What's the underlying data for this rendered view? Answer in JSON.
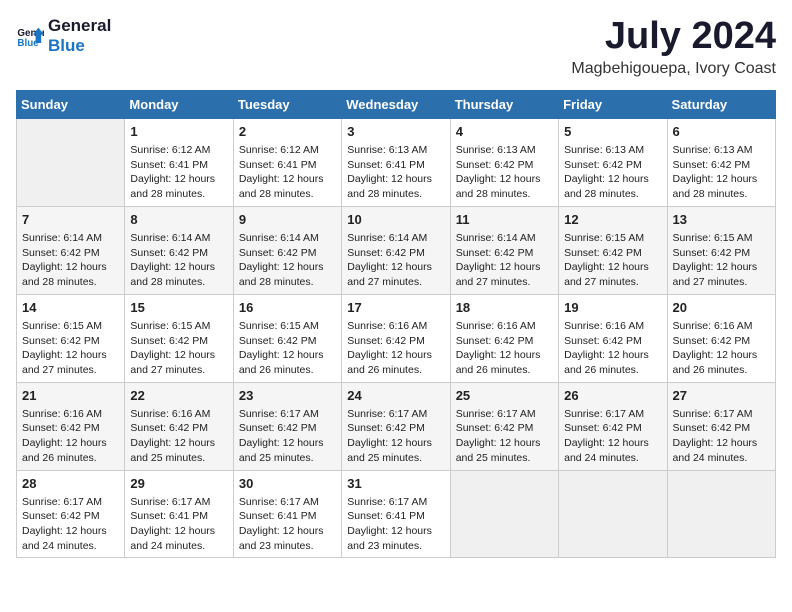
{
  "header": {
    "logo_line1": "General",
    "logo_line2": "Blue",
    "month": "July 2024",
    "location": "Magbehigouepa, Ivory Coast"
  },
  "weekdays": [
    "Sunday",
    "Monday",
    "Tuesday",
    "Wednesday",
    "Thursday",
    "Friday",
    "Saturday"
  ],
  "weeks": [
    [
      {
        "day": "",
        "empty": true
      },
      {
        "day": "1",
        "sunrise": "Sunrise: 6:12 AM",
        "sunset": "Sunset: 6:41 PM",
        "daylight": "Daylight: 12 hours and 28 minutes."
      },
      {
        "day": "2",
        "sunrise": "Sunrise: 6:12 AM",
        "sunset": "Sunset: 6:41 PM",
        "daylight": "Daylight: 12 hours and 28 minutes."
      },
      {
        "day": "3",
        "sunrise": "Sunrise: 6:13 AM",
        "sunset": "Sunset: 6:41 PM",
        "daylight": "Daylight: 12 hours and 28 minutes."
      },
      {
        "day": "4",
        "sunrise": "Sunrise: 6:13 AM",
        "sunset": "Sunset: 6:42 PM",
        "daylight": "Daylight: 12 hours and 28 minutes."
      },
      {
        "day": "5",
        "sunrise": "Sunrise: 6:13 AM",
        "sunset": "Sunset: 6:42 PM",
        "daylight": "Daylight: 12 hours and 28 minutes."
      },
      {
        "day": "6",
        "sunrise": "Sunrise: 6:13 AM",
        "sunset": "Sunset: 6:42 PM",
        "daylight": "Daylight: 12 hours and 28 minutes."
      }
    ],
    [
      {
        "day": "7",
        "sunrise": "Sunrise: 6:14 AM",
        "sunset": "Sunset: 6:42 PM",
        "daylight": "Daylight: 12 hours and 28 minutes."
      },
      {
        "day": "8",
        "sunrise": "Sunrise: 6:14 AM",
        "sunset": "Sunset: 6:42 PM",
        "daylight": "Daylight: 12 hours and 28 minutes."
      },
      {
        "day": "9",
        "sunrise": "Sunrise: 6:14 AM",
        "sunset": "Sunset: 6:42 PM",
        "daylight": "Daylight: 12 hours and 28 minutes."
      },
      {
        "day": "10",
        "sunrise": "Sunrise: 6:14 AM",
        "sunset": "Sunset: 6:42 PM",
        "daylight": "Daylight: 12 hours and 27 minutes."
      },
      {
        "day": "11",
        "sunrise": "Sunrise: 6:14 AM",
        "sunset": "Sunset: 6:42 PM",
        "daylight": "Daylight: 12 hours and 27 minutes."
      },
      {
        "day": "12",
        "sunrise": "Sunrise: 6:15 AM",
        "sunset": "Sunset: 6:42 PM",
        "daylight": "Daylight: 12 hours and 27 minutes."
      },
      {
        "day": "13",
        "sunrise": "Sunrise: 6:15 AM",
        "sunset": "Sunset: 6:42 PM",
        "daylight": "Daylight: 12 hours and 27 minutes."
      }
    ],
    [
      {
        "day": "14",
        "sunrise": "Sunrise: 6:15 AM",
        "sunset": "Sunset: 6:42 PM",
        "daylight": "Daylight: 12 hours and 27 minutes."
      },
      {
        "day": "15",
        "sunrise": "Sunrise: 6:15 AM",
        "sunset": "Sunset: 6:42 PM",
        "daylight": "Daylight: 12 hours and 27 minutes."
      },
      {
        "day": "16",
        "sunrise": "Sunrise: 6:15 AM",
        "sunset": "Sunset: 6:42 PM",
        "daylight": "Daylight: 12 hours and 26 minutes."
      },
      {
        "day": "17",
        "sunrise": "Sunrise: 6:16 AM",
        "sunset": "Sunset: 6:42 PM",
        "daylight": "Daylight: 12 hours and 26 minutes."
      },
      {
        "day": "18",
        "sunrise": "Sunrise: 6:16 AM",
        "sunset": "Sunset: 6:42 PM",
        "daylight": "Daylight: 12 hours and 26 minutes."
      },
      {
        "day": "19",
        "sunrise": "Sunrise: 6:16 AM",
        "sunset": "Sunset: 6:42 PM",
        "daylight": "Daylight: 12 hours and 26 minutes."
      },
      {
        "day": "20",
        "sunrise": "Sunrise: 6:16 AM",
        "sunset": "Sunset: 6:42 PM",
        "daylight": "Daylight: 12 hours and 26 minutes."
      }
    ],
    [
      {
        "day": "21",
        "sunrise": "Sunrise: 6:16 AM",
        "sunset": "Sunset: 6:42 PM",
        "daylight": "Daylight: 12 hours and 26 minutes."
      },
      {
        "day": "22",
        "sunrise": "Sunrise: 6:16 AM",
        "sunset": "Sunset: 6:42 PM",
        "daylight": "Daylight: 12 hours and 25 minutes."
      },
      {
        "day": "23",
        "sunrise": "Sunrise: 6:17 AM",
        "sunset": "Sunset: 6:42 PM",
        "daylight": "Daylight: 12 hours and 25 minutes."
      },
      {
        "day": "24",
        "sunrise": "Sunrise: 6:17 AM",
        "sunset": "Sunset: 6:42 PM",
        "daylight": "Daylight: 12 hours and 25 minutes."
      },
      {
        "day": "25",
        "sunrise": "Sunrise: 6:17 AM",
        "sunset": "Sunset: 6:42 PM",
        "daylight": "Daylight: 12 hours and 25 minutes."
      },
      {
        "day": "26",
        "sunrise": "Sunrise: 6:17 AM",
        "sunset": "Sunset: 6:42 PM",
        "daylight": "Daylight: 12 hours and 24 minutes."
      },
      {
        "day": "27",
        "sunrise": "Sunrise: 6:17 AM",
        "sunset": "Sunset: 6:42 PM",
        "daylight": "Daylight: 12 hours and 24 minutes."
      }
    ],
    [
      {
        "day": "28",
        "sunrise": "Sunrise: 6:17 AM",
        "sunset": "Sunset: 6:42 PM",
        "daylight": "Daylight: 12 hours and 24 minutes."
      },
      {
        "day": "29",
        "sunrise": "Sunrise: 6:17 AM",
        "sunset": "Sunset: 6:41 PM",
        "daylight": "Daylight: 12 hours and 24 minutes."
      },
      {
        "day": "30",
        "sunrise": "Sunrise: 6:17 AM",
        "sunset": "Sunset: 6:41 PM",
        "daylight": "Daylight: 12 hours and 23 minutes."
      },
      {
        "day": "31",
        "sunrise": "Sunrise: 6:17 AM",
        "sunset": "Sunset: 6:41 PM",
        "daylight": "Daylight: 12 hours and 23 minutes."
      },
      {
        "day": "",
        "empty": true
      },
      {
        "day": "",
        "empty": true
      },
      {
        "day": "",
        "empty": true
      }
    ]
  ]
}
